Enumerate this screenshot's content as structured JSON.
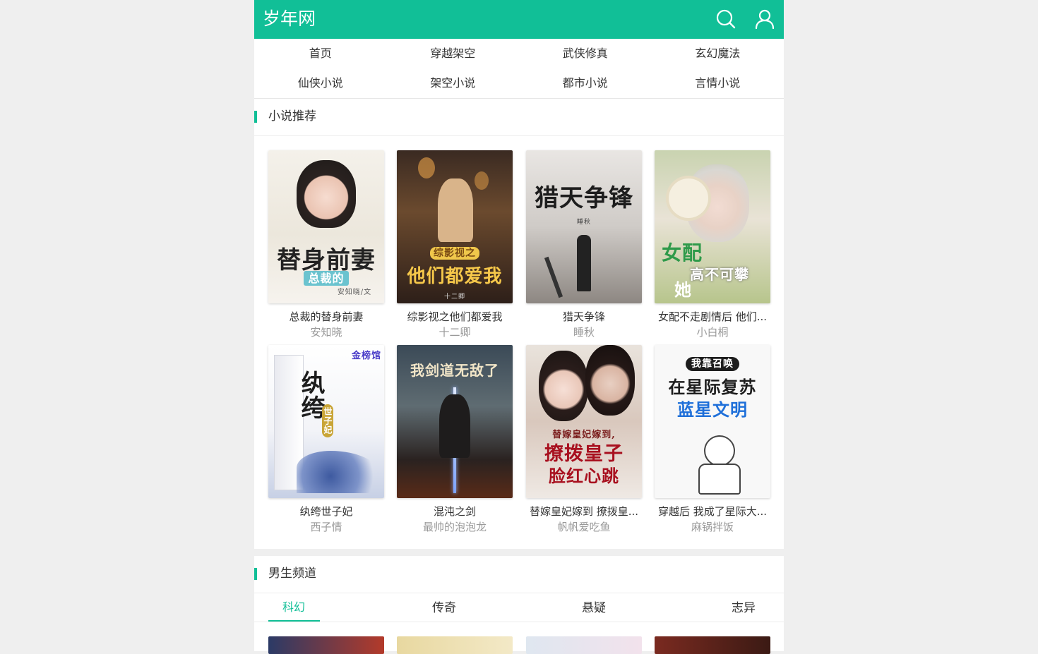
{
  "header": {
    "logo": "岁年网",
    "search_icon": "search-icon",
    "user_icon": "user-icon",
    "color": "#11bf97"
  },
  "nav": [
    {
      "label": "首页"
    },
    {
      "label": "穿越架空"
    },
    {
      "label": "武侠修真"
    },
    {
      "label": "玄幻魔法"
    },
    {
      "label": "仙侠小说"
    },
    {
      "label": "架空小说"
    },
    {
      "label": "都市小说"
    },
    {
      "label": "言情小说"
    }
  ],
  "recommend": {
    "title": "小说推荐",
    "books": [
      {
        "title": "总裁的替身前妻",
        "author": "安知晓",
        "cover_text": "替身前妻",
        "cover_sub": "总裁的",
        "cover_credit": "安知晓/文"
      },
      {
        "title": "综影视之他们都爱我",
        "author": "十二卿",
        "cover_text": "他们都爱我",
        "cover_sub": "综影视之",
        "cover_credit": "十二卿"
      },
      {
        "title": "猎天争锋",
        "author": "睡秋",
        "cover_text": "猎天争锋",
        "cover_sub": "",
        "cover_credit": "睡秋"
      },
      {
        "title": "女配不走剧情后 他们...",
        "author": "小白桐",
        "cover_text": "高不可攀",
        "cover_sub": "女配",
        "cover_credit": "她"
      },
      {
        "title": "纨绔世子妃",
        "author": "西子情",
        "cover_text": "纨绔",
        "cover_sub": "世子妃",
        "cover_credit": "金榜馆"
      },
      {
        "title": "混沌之剑",
        "author": "最帅的泡泡龙",
        "cover_text": "我剑道无敌了",
        "cover_sub": "",
        "cover_credit": ""
      },
      {
        "title": "替嫁皇妃嫁到 撩拨皇...",
        "author": "帆帆爱吃鱼",
        "cover_text": "撩拨皇子",
        "cover_sub": "替嫁皇妃嫁到,",
        "cover_credit": "脸红心跳"
      },
      {
        "title": "穿越后 我成了星际大...",
        "author": "麻锅拌饭",
        "cover_text": "在星际复苏",
        "cover_sub": "我靠召唤",
        "cover_credit": "蓝星文明"
      }
    ]
  },
  "male_channel": {
    "title": "男生频道",
    "tabs": [
      {
        "label": "科幻",
        "active": true
      },
      {
        "label": "传奇",
        "active": false
      },
      {
        "label": "悬疑",
        "active": false
      },
      {
        "label": "志异",
        "active": false
      }
    ]
  }
}
